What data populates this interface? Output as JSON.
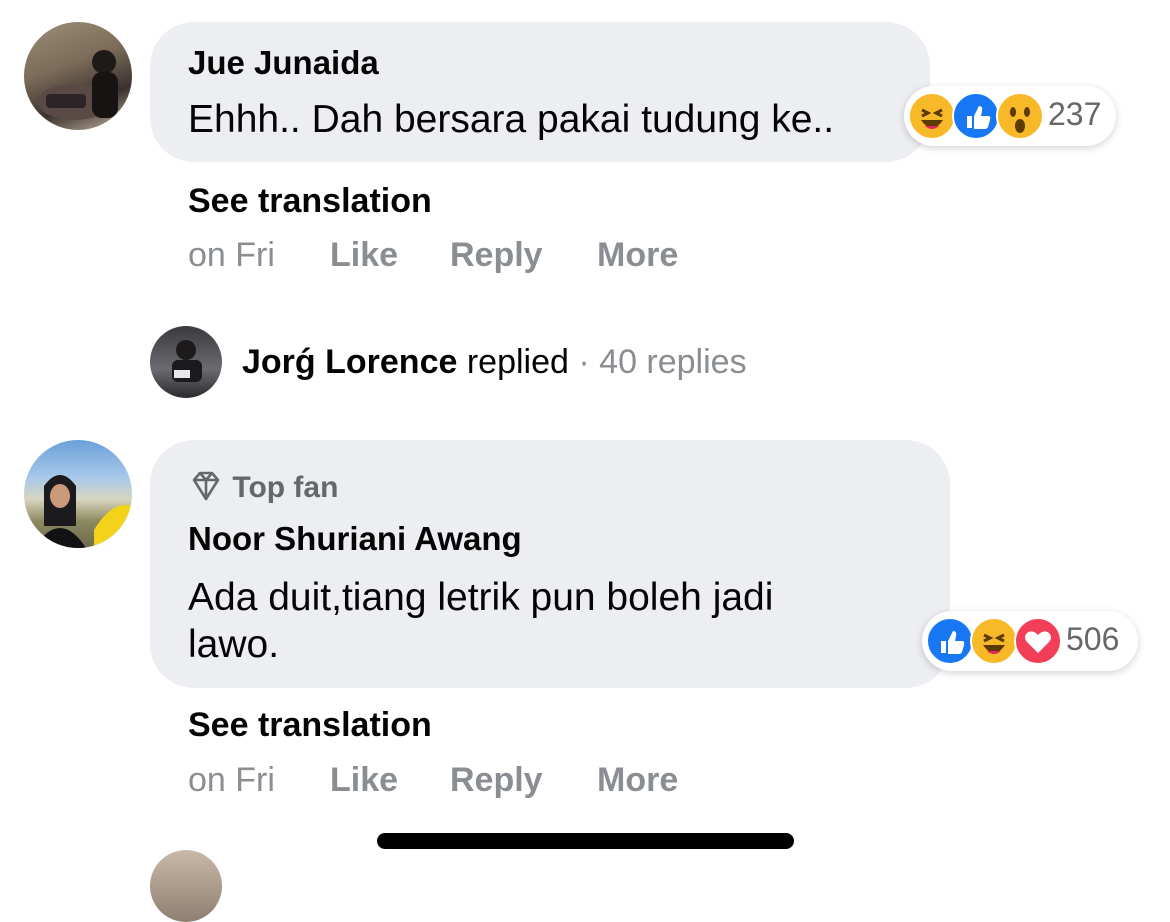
{
  "comments": [
    {
      "author": "Jue Junaida",
      "text": "Ehhh.. Dah bersara pakai tudung ke..",
      "reaction_count": "237",
      "reaction_icons": [
        "haha-icon",
        "like-icon",
        "wow-icon"
      ],
      "see_translation": "See translation",
      "time": "on Fri",
      "like": "Like",
      "reply": "Reply",
      "more": "More"
    },
    {
      "badge": "Top fan",
      "author": "Noor Shuriani Awang",
      "text_line1": "Ada duit,tiang letrik pun boleh jadi",
      "text_line2": "lawo.",
      "reaction_count": "506",
      "reaction_icons": [
        "like-icon",
        "haha-icon",
        "love-icon"
      ],
      "see_translation": "See translation",
      "time": "on Fri",
      "like": "Like",
      "reply": "Reply",
      "more": "More"
    }
  ],
  "reply_summary": {
    "name": "Jorǵ Lorence",
    "verb": "replied",
    "sep": "·",
    "count": "40 replies"
  },
  "colors": {
    "bubble": "#eceef2",
    "secondary_text": "#8a8d91",
    "like_blue": "#1877f2",
    "haha_yellow": "#f7b928",
    "love_red": "#f33e58"
  }
}
